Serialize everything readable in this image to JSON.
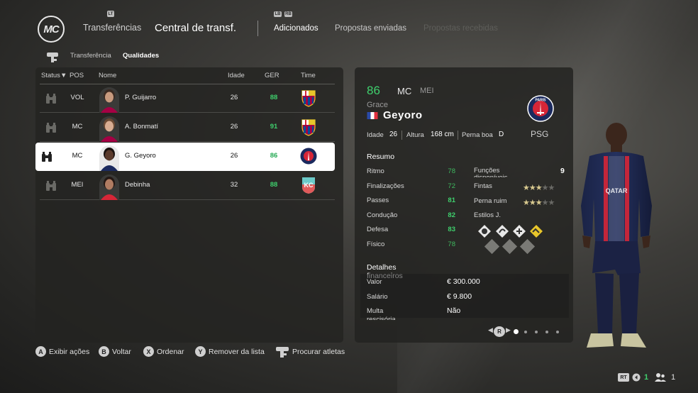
{
  "header": {
    "logo_text": "MC",
    "nav_transfers": "Transferências",
    "title": "Central de transf.",
    "tabs": [
      {
        "label": "Adicionados",
        "state": "active"
      },
      {
        "label": "Propostas enviadas",
        "state": "normal"
      },
      {
        "label": "Propostas recebidas",
        "state": "disabled"
      }
    ],
    "hint_left": "LT",
    "hint_lb": "LB",
    "hint_rb": "RB"
  },
  "subtabs": [
    {
      "label": "Transferência",
      "state": "normal"
    },
    {
      "label": "Qualidades",
      "state": "active"
    }
  ],
  "list": {
    "columns": {
      "status": "Status",
      "pos": "POS",
      "name": "Nome",
      "age": "Idade",
      "ovr": "GER",
      "team": "Time"
    },
    "rows": [
      {
        "pos": "VOL",
        "name": "P. Guijarro",
        "age": "26",
        "ovr": "88",
        "club": "barcelona",
        "skin": "#c89a7e",
        "hair": "#3a2a22"
      },
      {
        "pos": "MC",
        "name": "A. Bonmatí",
        "age": "26",
        "ovr": "91",
        "club": "barcelona",
        "skin": "#d8ad92",
        "hair": "#6b4a33"
      },
      {
        "pos": "MC",
        "name": "G. Geyoro",
        "age": "26",
        "ovr": "86",
        "club": "psg",
        "skin": "#5a3a2c",
        "hair": "#1a1210",
        "selected": true
      },
      {
        "pos": "MEI",
        "name": "Debinha",
        "age": "32",
        "ovr": "88",
        "club": "kc",
        "skin": "#b07c62",
        "hair": "#241814"
      }
    ]
  },
  "detail": {
    "ovr": "86",
    "pos_primary": "MC",
    "pos_alt": "MEI",
    "first_name": "Grace",
    "last_name": "Geyoro",
    "age_label": "Idade",
    "age": "26",
    "height_label": "Altura",
    "height": "168 cm",
    "foot_label": "Perna boa",
    "foot": "D",
    "club": "PSG",
    "club_badge_text": "PARIS",
    "summary_label": "Resumo",
    "stats": [
      {
        "label": "Ritmo",
        "value": "78"
      },
      {
        "label": "Finalizações",
        "value": "72"
      },
      {
        "label": "Passes",
        "value": "81"
      },
      {
        "label": "Condução",
        "value": "82"
      },
      {
        "label": "Defesa",
        "value": "83"
      },
      {
        "label": "Físico",
        "value": "78"
      }
    ],
    "functions_label": "Funções disponíveis",
    "functions_value": "9",
    "skill_moves_label": "Fintas",
    "skill_moves": 3,
    "weak_foot_label": "Perna ruim",
    "weak_foot": 3,
    "styles_label": "Estilos J.",
    "financial_label": "Detalhes financeiros",
    "financials": [
      {
        "label": "Valor",
        "value": "€ 300.000"
      },
      {
        "label": "Salário",
        "value": "€ 9.800"
      },
      {
        "label": "Multa rescisória",
        "value": "Não"
      }
    ],
    "pager_button": "R",
    "pager_pages": 5,
    "pager_active": 1
  },
  "footer": {
    "actions": [
      {
        "key": "A",
        "label": "Exibir ações"
      },
      {
        "key": "B",
        "label": "Voltar"
      },
      {
        "key": "X",
        "label": "Ordenar"
      },
      {
        "key": "Y",
        "label": "Remover da lista"
      },
      {
        "key": "",
        "label": "Procurar atletas"
      }
    ],
    "rt_label": "RT",
    "count_left": "1",
    "count_right": "1"
  },
  "colors": {
    "accent_green": "#3fd06d",
    "panel_bg": "#232321",
    "psg_blue": "#1b2a5e",
    "psg_red": "#d62637",
    "barca_red": "#a50044",
    "barca_blue": "#004d98"
  }
}
